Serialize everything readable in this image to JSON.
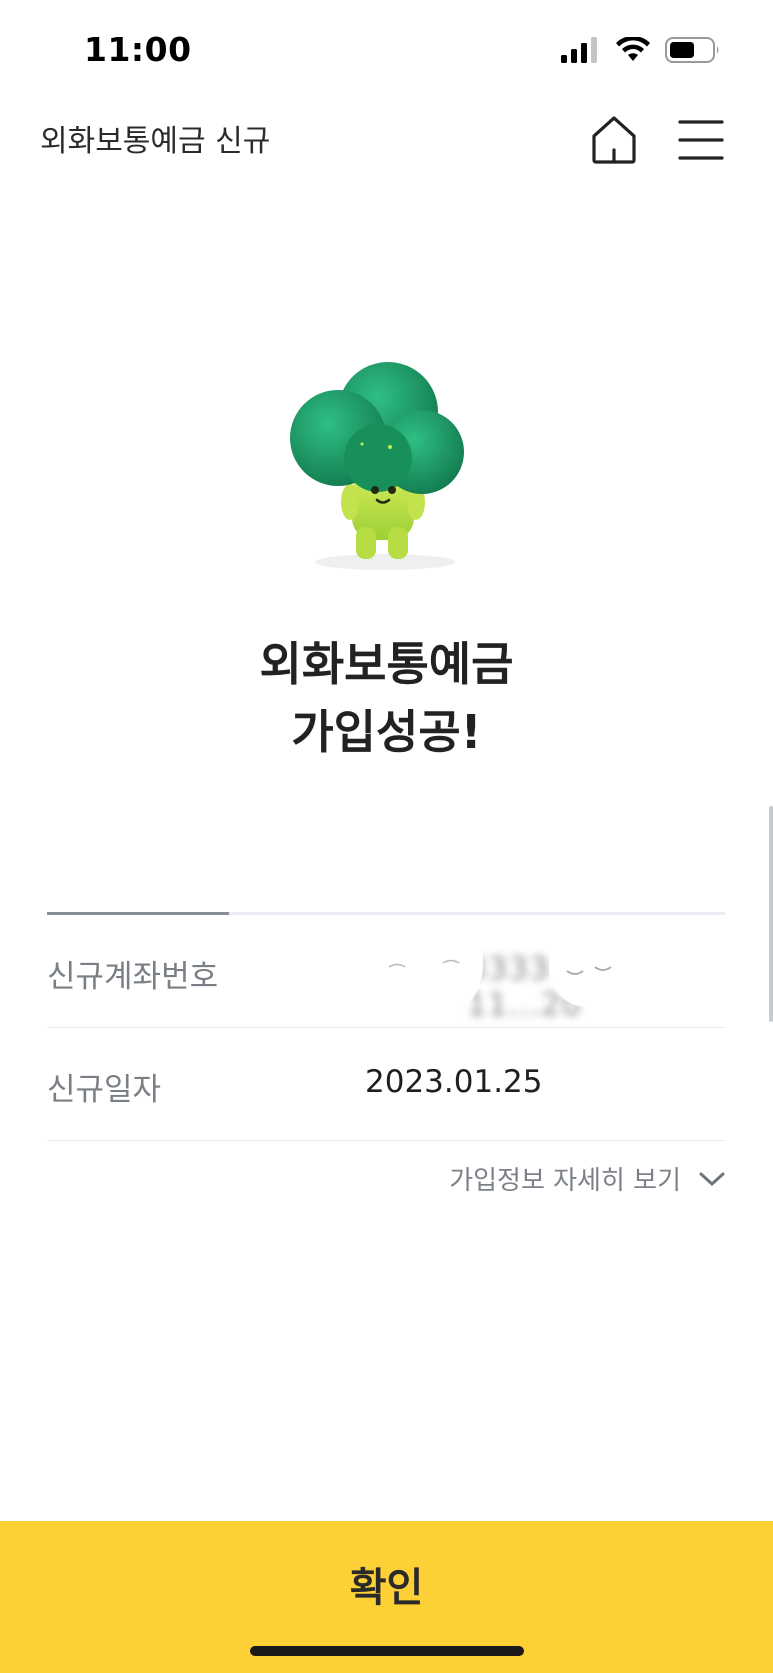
{
  "status_bar": {
    "time": "11:00",
    "icons": [
      "signal-icon",
      "wifi-icon",
      "battery-icon"
    ],
    "battery_level": 0.6
  },
  "header": {
    "title": "외화보통예금 신규",
    "icons": [
      "home-icon",
      "menu-icon"
    ]
  },
  "success": {
    "line1": "외화보통예금",
    "line2": "가입성공!"
  },
  "info": {
    "rows": [
      {
        "label": "신규계좌번호",
        "value": "3333-28-11...20"
      },
      {
        "label": "신규일자",
        "value": "2023.01.25"
      }
    ]
  },
  "details_link": {
    "label": "가입정보 자세히 보기",
    "icon": "chevron-down-icon"
  },
  "confirm": {
    "label": "확인"
  },
  "colors": {
    "accent": "#fdd035",
    "label_gray": "#7a7f86",
    "character_green": "#1e9e6a",
    "character_body": "#b6e04a"
  }
}
